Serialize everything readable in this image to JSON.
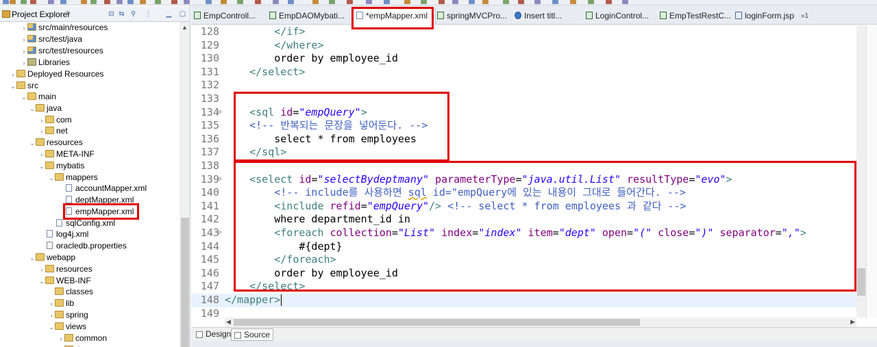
{
  "explorer": {
    "title": "Project Explorer",
    "close_glyph": "×",
    "header_icons": [
      "collapse-all-icon",
      "link-editor-icon",
      "filter-icon",
      "view-menu-icon",
      "minimize-icon",
      "maximize-icon"
    ],
    "items": [
      {
        "label": "src/main/resources",
        "icon": "source-folder-icon",
        "expanded": false
      },
      {
        "label": "src/test/java",
        "icon": "source-folder-icon",
        "expanded": false
      },
      {
        "label": "src/test/resources",
        "icon": "source-folder-icon",
        "expanded": false
      },
      {
        "label": "Libraries",
        "icon": "library-icon",
        "expanded": false
      },
      {
        "label": "Deployed Resources",
        "icon": "folder-icon",
        "expanded": false
      },
      {
        "label": "src",
        "icon": "folder-icon",
        "expanded": true
      },
      {
        "label": "main",
        "icon": "folder-icon",
        "expanded": true
      },
      {
        "label": "java",
        "icon": "folder-icon",
        "expanded": true
      },
      {
        "label": "com",
        "icon": "folder-icon",
        "expanded": false
      },
      {
        "label": "net",
        "icon": "folder-icon",
        "expanded": false
      },
      {
        "label": "resources",
        "icon": "folder-icon",
        "expanded": true
      },
      {
        "label": "META-INF",
        "icon": "folder-icon",
        "expanded": false
      },
      {
        "label": "mybatis",
        "icon": "folder-icon",
        "expanded": true
      },
      {
        "label": "mappers",
        "icon": "folder-icon",
        "expanded": true
      },
      {
        "label": "accountMapper.xml",
        "icon": "xml-file-icon"
      },
      {
        "label": "deptMapper.xml",
        "icon": "xml-file-icon"
      },
      {
        "label": "empMapper.xml",
        "icon": "xml-file-icon",
        "highlighted": true
      },
      {
        "label": "sqlConfig.xml",
        "icon": "xml-file-icon"
      },
      {
        "label": "log4j.xml",
        "icon": "xml-file-icon"
      },
      {
        "label": "oracledb.properties",
        "icon": "properties-file-icon"
      },
      {
        "label": "webapp",
        "icon": "folder-icon",
        "expanded": true
      },
      {
        "label": "resources",
        "icon": "folder-icon",
        "expanded": false
      },
      {
        "label": "WEB-INF",
        "icon": "folder-icon",
        "expanded": true
      },
      {
        "label": "classes",
        "icon": "folder-icon"
      },
      {
        "label": "lib",
        "icon": "folder-icon",
        "expanded": false
      },
      {
        "label": "spring",
        "icon": "folder-icon",
        "expanded": false
      },
      {
        "label": "views",
        "icon": "folder-icon",
        "expanded": true
      },
      {
        "label": "common",
        "icon": "folder-icon",
        "expanded": false
      },
      {
        "label": "dept",
        "icon": "folder-icon",
        "expanded": false
      }
    ]
  },
  "editor": {
    "tabs": [
      {
        "label": "EmpControll...",
        "icon": "java-file-icon"
      },
      {
        "label": "EmpDAOMybati...",
        "icon": "java-file-icon"
      },
      {
        "label": "*empMapper.xml",
        "icon": "xml-file-icon",
        "active": true,
        "close": "×"
      },
      {
        "label": "springMVCPro...",
        "icon": "java-file-icon"
      },
      {
        "label": "Insert titl...",
        "icon": "browser-icon"
      },
      {
        "label": "LoginControl...",
        "icon": "java-file-icon"
      },
      {
        "label": "EmpTestRestC...",
        "icon": "java-file-icon"
      },
      {
        "label": "loginForm.jsp",
        "icon": "jsp-file-icon"
      }
    ],
    "tab_overflow": "»1",
    "lines": [
      {
        "n": "128",
        "segs": [
          {
            "t": "        "
          },
          {
            "t": "</if>",
            "c": "tg"
          }
        ]
      },
      {
        "n": "129",
        "segs": [
          {
            "t": "        "
          },
          {
            "t": "</where>",
            "c": "tg"
          }
        ]
      },
      {
        "n": "130",
        "segs": [
          {
            "t": "        order by employee_id",
            "c": "tx"
          }
        ]
      },
      {
        "n": "131",
        "segs": [
          {
            "t": "    "
          },
          {
            "t": "</select>",
            "c": "tg"
          }
        ]
      },
      {
        "n": "132",
        "segs": []
      },
      {
        "n": "133",
        "segs": []
      },
      {
        "n": "134",
        "fold": "⊖",
        "segs": [
          {
            "t": "    "
          },
          {
            "t": "<sql ",
            "c": "tg"
          },
          {
            "t": "id",
            "c": "at"
          },
          {
            "t": "=",
            "c": "tx"
          },
          {
            "t": "\"empQuery\"",
            "c": "av"
          },
          {
            "t": ">",
            "c": "tg"
          }
        ]
      },
      {
        "n": "135",
        "segs": [
          {
            "t": "    "
          },
          {
            "t": "<!-- 반복되는 문장을 넣어둔다. -->",
            "c": "cm"
          }
        ]
      },
      {
        "n": "136",
        "segs": [
          {
            "t": "        select * from employees",
            "c": "tx"
          }
        ]
      },
      {
        "n": "137",
        "segs": [
          {
            "t": "    "
          },
          {
            "t": "</sql>",
            "c": "tg"
          }
        ]
      },
      {
        "n": "138",
        "segs": []
      },
      {
        "n": "139",
        "fold": "⊖",
        "segs": [
          {
            "t": "    "
          },
          {
            "t": "<select ",
            "c": "tg"
          },
          {
            "t": "id",
            "c": "at"
          },
          {
            "t": "=",
            "c": "tx"
          },
          {
            "t": "\"selectBydeptmany\"",
            "c": "av"
          },
          {
            "t": " parameterType",
            "c": "at"
          },
          {
            "t": "=",
            "c": "tx"
          },
          {
            "t": "\"java.util.List\"",
            "c": "av"
          },
          {
            "t": " resultType",
            "c": "at"
          },
          {
            "t": "=",
            "c": "tx"
          },
          {
            "t": "\"evo\"",
            "c": "av"
          },
          {
            "t": ">",
            "c": "tg"
          }
        ]
      },
      {
        "n": "140",
        "segs": [
          {
            "t": "        "
          },
          {
            "t": "<!-- include를 사용하면 ",
            "c": "cm"
          },
          {
            "t": "sql",
            "c": "cm",
            "squig": true
          },
          {
            "t": " id=\"empQuery에 있는 내용이 그대로 들어간다. -->",
            "c": "cm"
          }
        ]
      },
      {
        "n": "141",
        "segs": [
          {
            "t": "        "
          },
          {
            "t": "<include ",
            "c": "tg"
          },
          {
            "t": "refid",
            "c": "at"
          },
          {
            "t": "=",
            "c": "tx"
          },
          {
            "t": "\"empQuery\"",
            "c": "av"
          },
          {
            "t": "/>",
            "c": "tg"
          },
          {
            "t": " "
          },
          {
            "t": "<!-- select * from employees 과 같다 -->",
            "c": "cm"
          }
        ]
      },
      {
        "n": "142",
        "segs": [
          {
            "t": "        where department_id in",
            "c": "tx"
          }
        ]
      },
      {
        "n": "143",
        "fold": "⊖",
        "segs": [
          {
            "t": "        "
          },
          {
            "t": "<foreach ",
            "c": "tg"
          },
          {
            "t": "collection",
            "c": "at"
          },
          {
            "t": "=",
            "c": "tx"
          },
          {
            "t": "\"List\"",
            "c": "av"
          },
          {
            "t": " index",
            "c": "at"
          },
          {
            "t": "=",
            "c": "tx"
          },
          {
            "t": "\"index\"",
            "c": "av"
          },
          {
            "t": " item",
            "c": "at"
          },
          {
            "t": "=",
            "c": "tx"
          },
          {
            "t": "\"dept\"",
            "c": "av"
          },
          {
            "t": " open",
            "c": "at"
          },
          {
            "t": "=",
            "c": "tx"
          },
          {
            "t": "\"(\"",
            "c": "av"
          },
          {
            "t": " close",
            "c": "at"
          },
          {
            "t": "=",
            "c": "tx"
          },
          {
            "t": "\")\"",
            "c": "av"
          },
          {
            "t": " separator",
            "c": "at"
          },
          {
            "t": "=",
            "c": "tx"
          },
          {
            "t": "\",\"",
            "c": "av"
          },
          {
            "t": ">",
            "c": "tg"
          }
        ]
      },
      {
        "n": "144",
        "segs": [
          {
            "t": "            #{dept}",
            "c": "tx"
          }
        ]
      },
      {
        "n": "145",
        "segs": [
          {
            "t": "        "
          },
          {
            "t": "</foreach>",
            "c": "tg"
          }
        ]
      },
      {
        "n": "146",
        "segs": [
          {
            "t": "        order by employee_id",
            "c": "tx"
          }
        ]
      },
      {
        "n": "147",
        "segs": [
          {
            "t": "    "
          },
          {
            "t": "</select>",
            "c": "tg"
          }
        ]
      },
      {
        "n": "148",
        "current": true,
        "segs": [
          {
            "t": "</mapper>",
            "c": "tg"
          }
        ]
      },
      {
        "n": "149",
        "segs": []
      }
    ],
    "bottom_tabs": [
      {
        "label": "Design",
        "icon": "design-view-icon"
      },
      {
        "label": "Source",
        "icon": "source-view-icon",
        "active": true
      }
    ]
  },
  "colors": {
    "tag": "#3f7f7f",
    "attribute": "#7f007f",
    "attribute_value": "#2a00ff",
    "comment": "#3f5fbf",
    "highlight_box": "#e00000",
    "current_line": "#e8f2fe"
  }
}
